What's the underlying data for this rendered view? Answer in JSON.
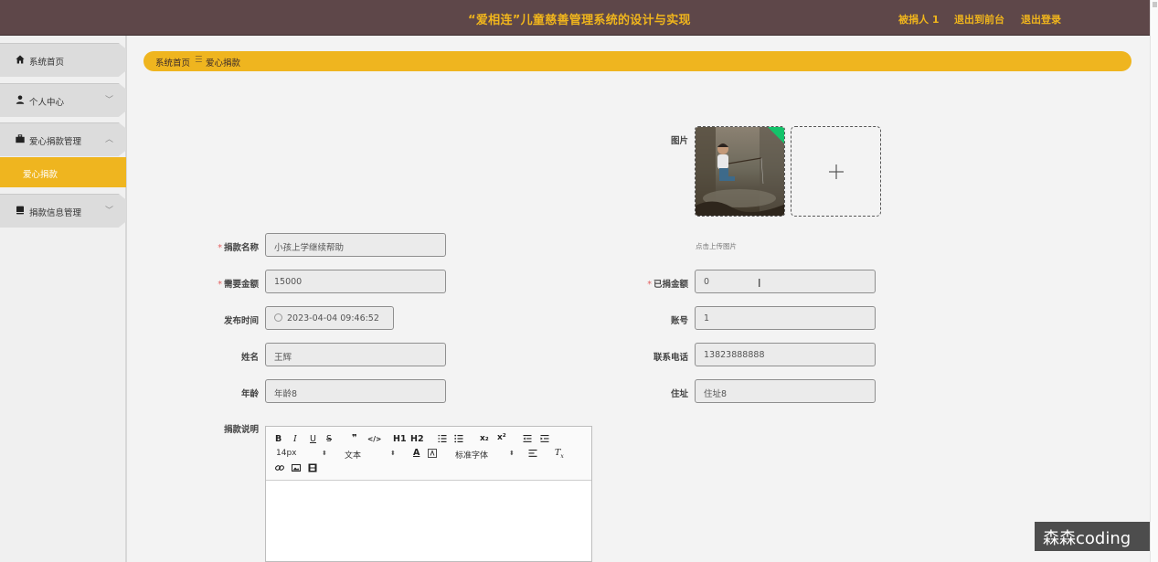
{
  "header": {
    "title": "“爱相连”儿童慈善管理系统的设计与实现",
    "user_label": "被捐人 1",
    "front_link": "退出到前台",
    "logout_link": "退出登录"
  },
  "sidebar": {
    "items": [
      {
        "label": "系统首页",
        "icon": "home-icon"
      },
      {
        "label": "个人中心",
        "icon": "person-icon"
      },
      {
        "label": "爱心捐款管理",
        "icon": "briefcase-icon",
        "expanded": true
      },
      {
        "label": "捐款信息管理",
        "icon": "document-icon"
      }
    ],
    "active_subitem": "爱心捐款"
  },
  "breadcrumb": {
    "home": "系统首页",
    "separator": "☰",
    "current": "爱心捐款"
  },
  "form": {
    "image_label": "图片",
    "upload_tip": "点击上传图片",
    "name": {
      "label": "捐款名称",
      "value": "小孩上学继续帮助"
    },
    "amount_needed": {
      "label": "需要金额",
      "value": "15000"
    },
    "amount_donated": {
      "label": "已捐金额",
      "value": "0"
    },
    "publish_time": {
      "label": "发布时间",
      "value": "2023-04-04 09:46:52"
    },
    "account": {
      "label": "账号",
      "value": "1"
    },
    "full_name": {
      "label": "姓名",
      "value": "王辉"
    },
    "phone": {
      "label": "联系电话",
      "value": "13823888888"
    },
    "age": {
      "label": "年龄",
      "value": "年龄8"
    },
    "address": {
      "label": "住址",
      "value": "住址8"
    },
    "description": {
      "label": "捐款说明",
      "value": ""
    }
  },
  "editor_toolbar": {
    "bold": "B",
    "italic": "I",
    "underline": "U",
    "strike": "S",
    "quote": "❞",
    "code": "</>",
    "h1": "H1",
    "h2": "H2",
    "subscript": "x₂",
    "superscript": "x²",
    "font_size": "14px",
    "format": "文本",
    "font_family": "标准字体"
  },
  "watermark": "森森coding",
  "colors": {
    "header_bg": "#5e4749",
    "accent": "#efb51f",
    "required": "#e35f5f",
    "upload_badge": "#13c36a"
  }
}
